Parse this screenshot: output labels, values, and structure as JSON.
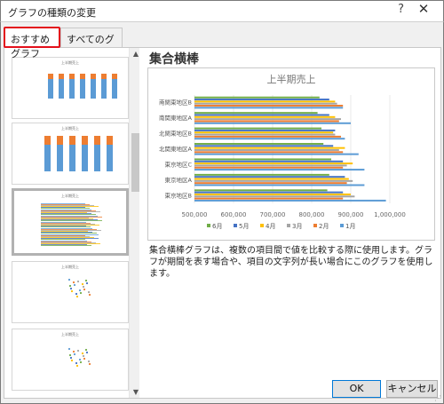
{
  "window": {
    "title": "グラフの種類の変更",
    "help_icon": "?",
    "close_icon": "✕"
  },
  "tabs": [
    {
      "label": "おすすめグラフ",
      "selected": true
    },
    {
      "label": "すべてのグラフ",
      "selected": false
    }
  ],
  "thumbnails": [
    {
      "title": "上半期売上",
      "kind": "stacked-column"
    },
    {
      "title": "上半期売上",
      "kind": "stacked-column-orange"
    },
    {
      "title": "上半期売上",
      "kind": "clustered-bar",
      "selected": true
    },
    {
      "title": "上半期売上",
      "kind": "scatter"
    },
    {
      "title": "上半期売上",
      "kind": "scatter"
    }
  ],
  "selected_type": {
    "name": "集合横棒",
    "description": "集合横棒グラフは、複数の項目間で値を比較する際に使用します。グラフが期間を表す場合や、項目の文字列が長い場合にこのグラフを使用します。"
  },
  "chart_data": {
    "type": "bar",
    "title": "上半期売上",
    "categories": [
      "東京地区B",
      "東京地区A",
      "東京地区C",
      "北関東地区A",
      "北関東地区B",
      "南関東地区A",
      "南関東地区B"
    ],
    "series": [
      {
        "name": "1月",
        "color": "#5b9bd5",
        "values": [
          990000,
          935000,
          935000,
          920000,
          885000,
          900000,
          880000
        ]
      },
      {
        "name": "2月",
        "color": "#ed7d31",
        "values": [
          880000,
          890000,
          880000,
          880000,
          875000,
          870000,
          880000
        ]
      },
      {
        "name": "3月",
        "color": "#a5a5a5",
        "values": [
          910000,
          905000,
          890000,
          870000,
          860000,
          875000,
          865000
        ]
      },
      {
        "name": "4月",
        "color": "#ffc000",
        "values": [
          900000,
          895000,
          905000,
          885000,
          855000,
          860000,
          860000
        ]
      },
      {
        "name": "5月",
        "color": "#4472c4",
        "values": [
          880000,
          885000,
          880000,
          855000,
          860000,
          845000,
          845000
        ]
      },
      {
        "name": "6月",
        "color": "#70ad47",
        "values": [
          840000,
          845000,
          850000,
          830000,
          825000,
          815000,
          820000
        ]
      }
    ],
    "legend_order": [
      "6月",
      "5月",
      "4月",
      "3月",
      "2月",
      "1月"
    ],
    "xlim": [
      500000,
      1000000
    ],
    "xticks": [
      "500,000",
      "600,000",
      "700,000",
      "800,000",
      "900,000",
      "1,000,000"
    ],
    "legend_position": "bottom",
    "grid": true
  },
  "buttons": {
    "ok": "OK",
    "cancel": "キャンセル"
  }
}
